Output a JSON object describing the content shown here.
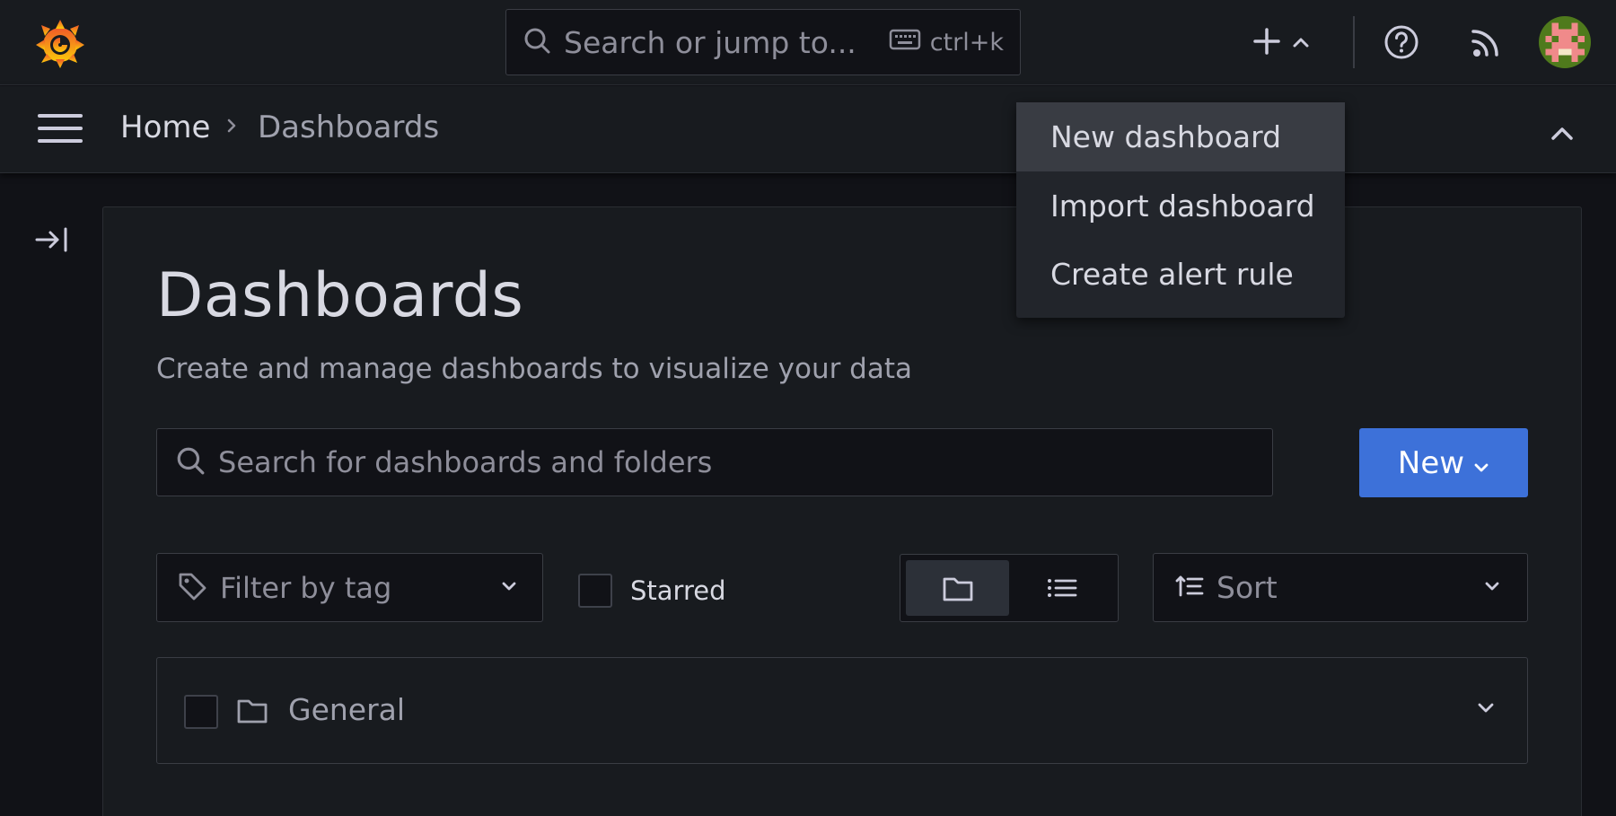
{
  "topbar": {
    "search_placeholder": "Search or jump to...",
    "shortcut": "ctrl+k"
  },
  "breadcrumb": {
    "home": "Home",
    "current": "Dashboards"
  },
  "page": {
    "title": "Dashboards",
    "subtitle": "Create and manage dashboards to visualize your data"
  },
  "search": {
    "placeholder": "Search for dashboards and folders"
  },
  "new_button": {
    "label": "New"
  },
  "filters": {
    "tag_placeholder": "Filter by tag",
    "starred_label": "Starred",
    "sort_placeholder": "Sort",
    "active_view": "folder"
  },
  "folders": [
    {
      "name": "General"
    }
  ],
  "new_menu": {
    "items": [
      {
        "label": "New dashboard"
      },
      {
        "label": "Import dashboard"
      },
      {
        "label": "Create alert rule"
      }
    ]
  },
  "colors": {
    "primary_button": "#3d71d9",
    "background": "#111217",
    "surface": "#181b1f"
  }
}
